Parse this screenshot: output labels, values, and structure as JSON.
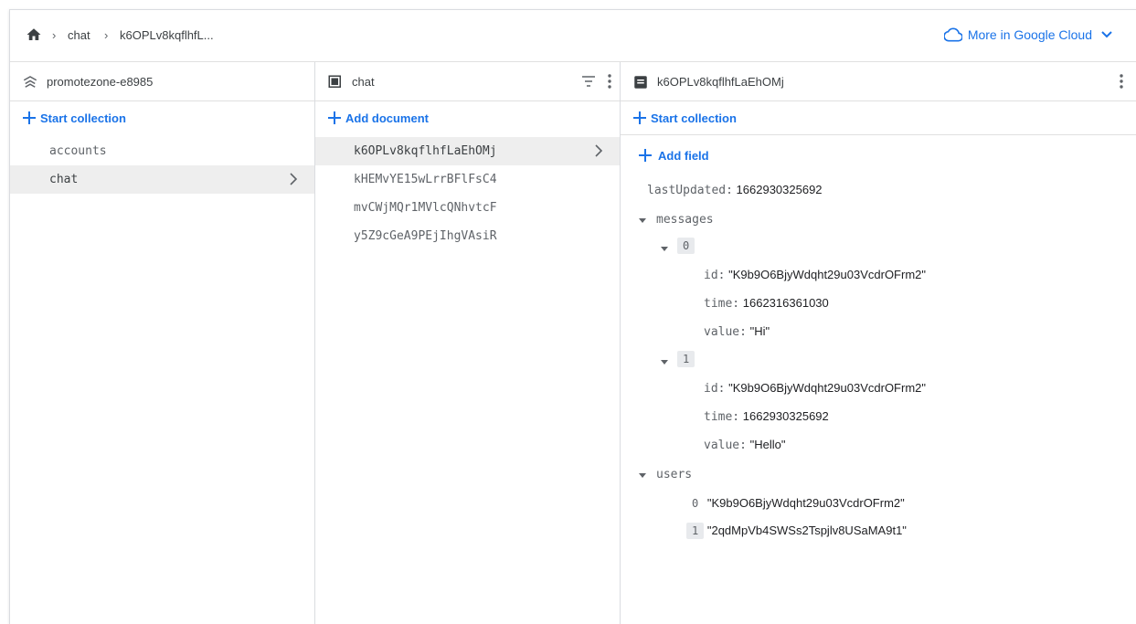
{
  "breadcrumb": {
    "items": [
      "chat",
      "k6OPLv8kqflhfL..."
    ]
  },
  "header_link": "More in Google Cloud",
  "colors": {
    "accent": "#1a73e8",
    "selected_bg": "#eeeeee"
  },
  "col1": {
    "title": "promotezone-e8985",
    "action": "Start collection",
    "items": [
      "accounts",
      "chat"
    ]
  },
  "col2": {
    "title": "chat",
    "action": "Add document",
    "items": [
      "k6OPLv8kqflhfLaEhOMj",
      "kHEMvYE15wLrrBFlFsC4",
      "mvCWjMQr1MVlcQNhvtcF",
      "y5Z9cGeA9PEjIhgVAsiR"
    ]
  },
  "col3": {
    "title": "k6OPLv8kqflhfLaEhOMj",
    "action": "Start collection",
    "add_field": "Add field",
    "lastUpdated_key": "lastUpdated:",
    "lastUpdated_val": "1662930325692",
    "messages_key": "messages",
    "msg0_idx": "0",
    "msg0_id_key": "id:",
    "msg0_id_val": "\"K9b9O6BjyWdqht29u03VcdrOFrm2\"",
    "msg0_time_key": "time:",
    "msg0_time_val": "1662316361030",
    "msg0_value_key": "value:",
    "msg0_value_val": "\"Hi\"",
    "msg1_idx": "1",
    "msg1_id_key": "id:",
    "msg1_id_val": "\"K9b9O6BjyWdqht29u03VcdrOFrm2\"",
    "msg1_time_key": "time:",
    "msg1_time_val": "1662930325692",
    "msg1_value_key": "value:",
    "msg1_value_val": "\"Hello\"",
    "users_key": "users",
    "user0_idx": "0",
    "user0_val": "\"K9b9O6BjyWdqht29u03VcdrOFrm2\"",
    "user1_idx": "1",
    "user1_val": "\"2qdMpVb4SWSs2Tspjlv8USaMA9t1\""
  }
}
